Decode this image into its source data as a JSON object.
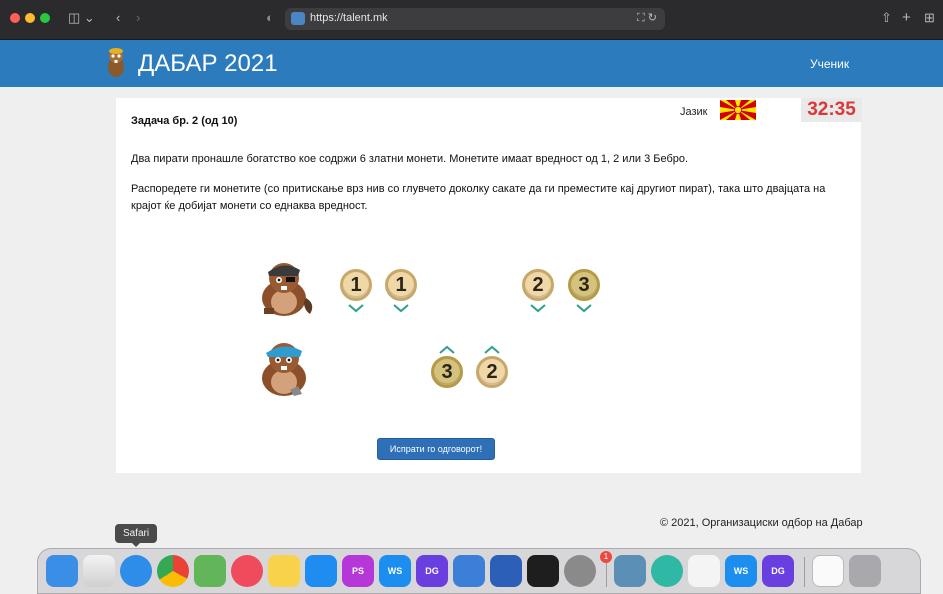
{
  "browser": {
    "url": "https://talent.mk",
    "tooltip": "Safari"
  },
  "header": {
    "title": "ДАБАР 2021",
    "user_label": "Ученик"
  },
  "task": {
    "title": "Задача бр. 2   (од 10)",
    "language_label": "Јазик",
    "timer": "32:35",
    "paragraph_1": "Два пирати пронашле богатство кое содржи 6 златни монети. Монетите имаат вредност од 1, 2 или 3 Бебро.",
    "paragraph_2": "Распоредете ги монетите (со притискање врз нив со глувчето доколку сакате да ги преместите кај другиот пират), така што двајцата на крајот ќе добијат монети со еднаква вредност.",
    "submit_label": "Испрати го одговорот!"
  },
  "puzzle": {
    "pirate_top_coins": [
      "1",
      "1",
      "2",
      "3"
    ],
    "pirate_bottom_coins": [
      "3",
      "2"
    ]
  },
  "footer": {
    "text": "© 2021, Организациски одбор на Дабар"
  },
  "dock": {
    "badge": "1",
    "labels": [
      "PS",
      "WS",
      "DG",
      "WS",
      "DG"
    ],
    "icons": [
      "finder-icon",
      "launchpad-icon",
      "safari-icon",
      "chrome-icon",
      "maps-icon",
      "music-icon",
      "notes-icon",
      "appstore-icon",
      "phpstorm-icon",
      "webstorm-icon",
      "datagrip-icon",
      "xcode-icon",
      "word-icon",
      "terminal-icon",
      "system-preferences-icon",
      "preview-icon",
      "app-icon",
      "textedit-icon",
      "webstorm-icon",
      "datagrip-icon",
      "document-icon",
      "trash-icon"
    ]
  }
}
